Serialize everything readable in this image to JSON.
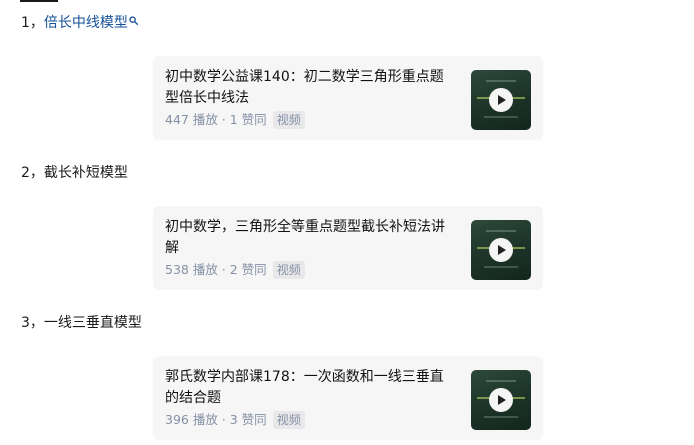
{
  "sections": [
    {
      "number": "1，",
      "title": "倍长中线模型",
      "icon": "search-icon",
      "card": {
        "title": "初中数学公益课140：初二数学三角形重点题型倍长中线法",
        "meta": "447 播放 · 1 赞同",
        "tag": "视频",
        "thumb_icon": "play-icon"
      }
    },
    {
      "number": "2，",
      "title": "截长补短模型",
      "card": {
        "title": "初中数学，三角形全等重点题型截长补短法讲解",
        "meta": "538 播放 · 2 赞同",
        "tag": "视频",
        "thumb_icon": "play-icon"
      }
    },
    {
      "number": "3，",
      "title": "一线三垂直模型",
      "card": {
        "title": "郭氏数学内部课178：一次函数和一线三垂直的结合题",
        "meta": "396 播放 · 3 赞同",
        "tag": "视频",
        "thumb_icon": "play-icon"
      }
    }
  ],
  "colors": {
    "link": "#175199",
    "card_bg": "#f6f6f6",
    "meta": "#8590a6"
  }
}
